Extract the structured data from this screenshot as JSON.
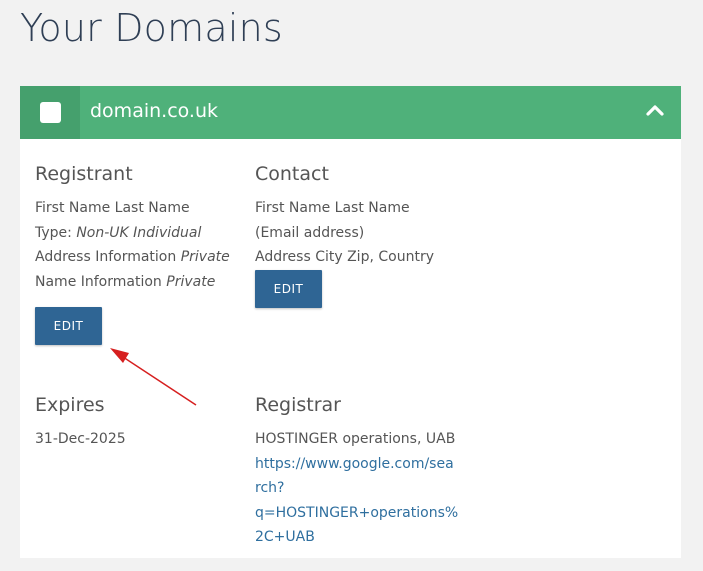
{
  "page": {
    "title": "Your Domains"
  },
  "domain": {
    "name": "domain.co.uk",
    "colors": {
      "header": "#4fb17a",
      "checkbox_cell": "#45a06d",
      "button": "#2f6594",
      "link": "#2f6f9f",
      "annotation_arrow": "#d61f1f"
    }
  },
  "registrant": {
    "heading": "Registrant",
    "name": "First Name Last Name",
    "type_label": "Type:",
    "type_value": "Non-UK Individual",
    "address_label": "Address Information",
    "address_value": "Private",
    "name_info_label": "Name Information",
    "name_info_value": "Private",
    "edit_label": "EDIT"
  },
  "contact": {
    "heading": "Contact",
    "name": "First Name Last Name",
    "email": "(Email address)",
    "address": "Address City Zip, Country",
    "edit_label": "EDIT"
  },
  "expires": {
    "heading": "Expires",
    "date": "31-Dec-2025"
  },
  "registrar": {
    "heading": "Registrar",
    "name": "HOSTINGER operations, UAB",
    "url_lines": [
      "https://www.google.com/sea",
      "rch?",
      "q=HOSTINGER+operations%",
      "2C+UAB"
    ]
  },
  "icons": {
    "collapse": "chevron-up-icon",
    "select": "checkbox-icon",
    "annotation": "red-arrow-icon"
  }
}
